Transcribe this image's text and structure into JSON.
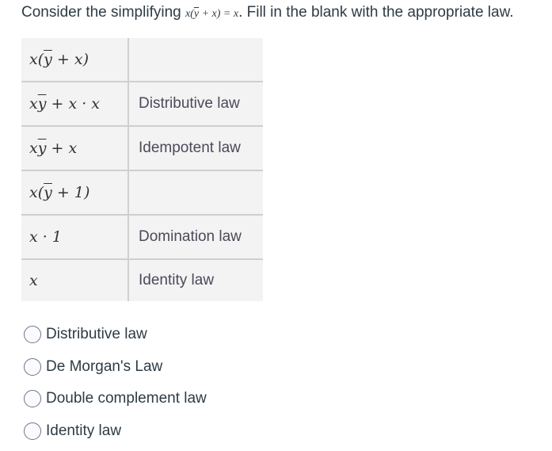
{
  "question": {
    "prefix": "Consider the simplifying ",
    "math_x": "x(",
    "math_ybar": "y",
    "math_rest": " + x) = x",
    "suffix": ". Fill in the blank with the appropriate law."
  },
  "table": {
    "rows": [
      {
        "expr_pre": "x(",
        "expr_bar": "y",
        "expr_post": " + x)",
        "law": ""
      },
      {
        "expr_pre": "x",
        "expr_bar": "y",
        "expr_post": " + x · x",
        "law": "Distributive law"
      },
      {
        "expr_pre": "x",
        "expr_bar": "y",
        "expr_post": " + x",
        "law": "Idempotent law"
      },
      {
        "expr_pre": "x(",
        "expr_bar": "y",
        "expr_post": " + 1)",
        "law": ""
      },
      {
        "expr_pre": "x · 1",
        "expr_bar": "",
        "expr_post": "",
        "law": "Domination law"
      },
      {
        "expr_pre": "x",
        "expr_bar": "",
        "expr_post": "",
        "law": "Identity law"
      }
    ]
  },
  "options": [
    {
      "label": "Distributive law",
      "selected": false
    },
    {
      "label": "De Morgan's Law",
      "selected": false
    },
    {
      "label": "Double complement law",
      "selected": false
    },
    {
      "label": "Identity law",
      "selected": false
    }
  ]
}
